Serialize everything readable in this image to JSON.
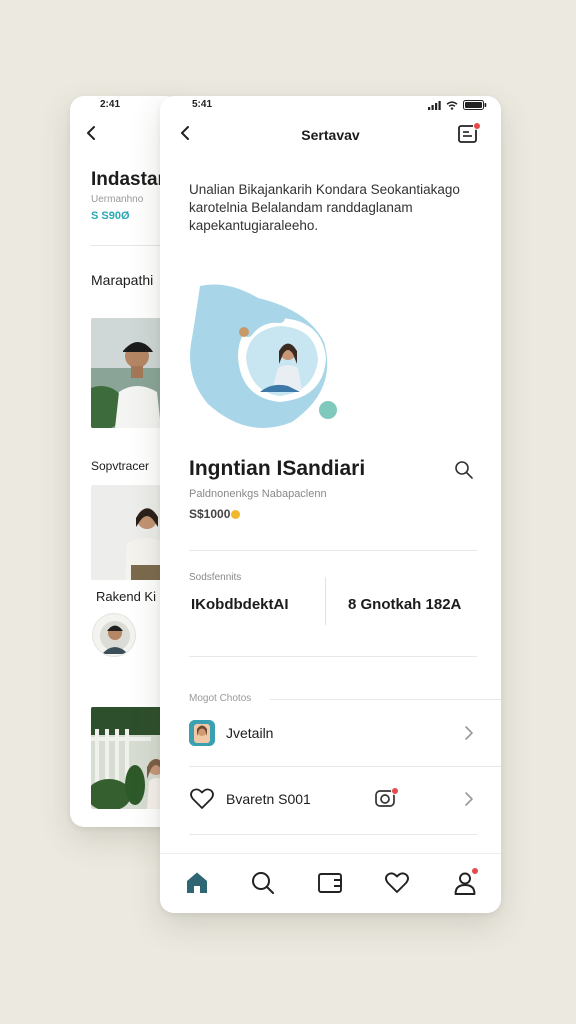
{
  "back_screen": {
    "status_time": "2:41",
    "title": "Indastar",
    "subtitle": "Uermanhno",
    "price": "S S90Ø",
    "section_1": "Marapathi",
    "section_2": "Sopvtracer",
    "person_name": "Rakend Ki"
  },
  "front_screen": {
    "status_time": "5:41",
    "nav_title": "Sertavav",
    "intro_text": "Unalian Bikajankarih Kondara Seokantiakago karotelnia Belalandam randdaglanam kapekantugiaraleeho.",
    "product": {
      "title": "Ingntian ISandiari",
      "subtitle": "Paldnonenkgs Nabapaclenn",
      "price": "S$1000"
    },
    "details": {
      "label": "Sodsfennits",
      "left_value": "IKobdbdektAI",
      "right_value": "8 Gnotkah 182A"
    },
    "more": {
      "label": "Mogot Chotos",
      "rows": [
        {
          "label": "Jvetailn"
        },
        {
          "label": "Bvaretn S001"
        }
      ]
    },
    "tab_bar": {
      "items": [
        "home-icon",
        "search-icon",
        "wallet-icon",
        "heart-icon",
        "profile-icon"
      ],
      "active": "home-icon"
    }
  },
  "colors": {
    "background": "#eceae0",
    "accent": "#2f6673",
    "hero_blue": "#a8d6e8",
    "teal_dot": "#7ec9bc",
    "badge": "#e54b4b",
    "price_coin": "#f0b72f"
  }
}
